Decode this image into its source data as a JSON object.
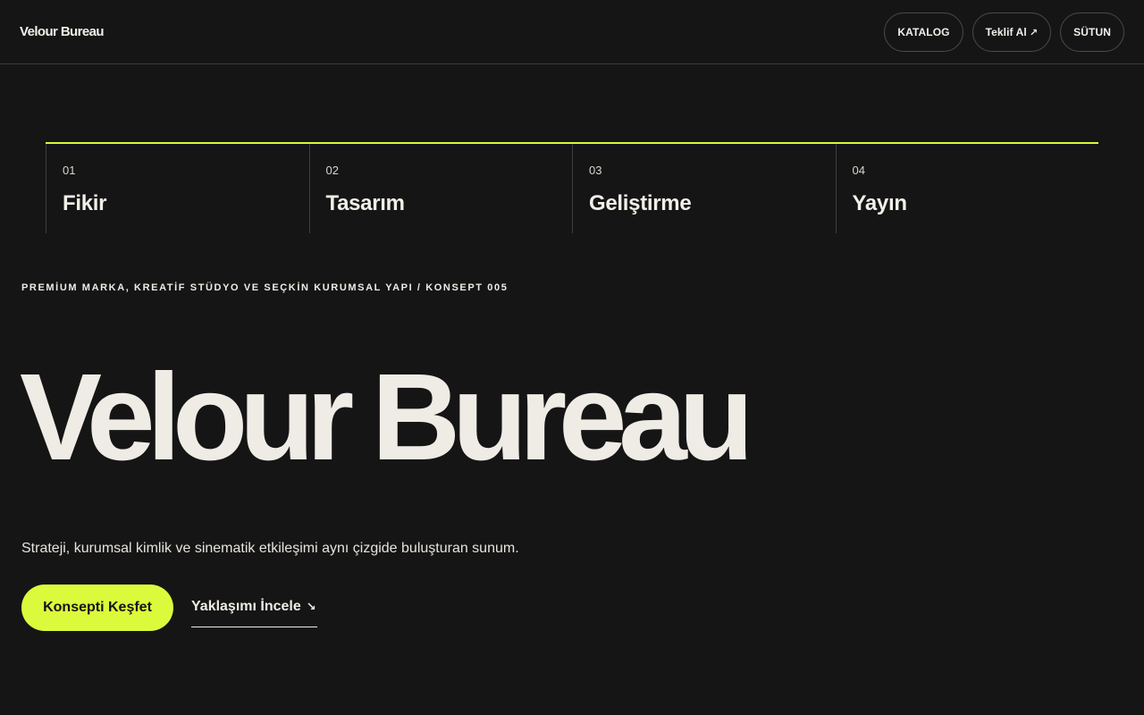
{
  "header": {
    "brand": "Velour Bureau",
    "nav": [
      {
        "label": "KATALOG",
        "icon": ""
      },
      {
        "label": "Teklif Al",
        "icon": "↗"
      },
      {
        "label": "SÜTUN",
        "icon": ""
      }
    ]
  },
  "steps": [
    {
      "num": "01",
      "title": "Fikir"
    },
    {
      "num": "02",
      "title": "Tasarım"
    },
    {
      "num": "03",
      "title": "Geliştirme"
    },
    {
      "num": "04",
      "title": "Yayın"
    }
  ],
  "hero": {
    "eyebrow": "PREMİUM MARKA, KREATİF STÜDYO VE SEÇKİN KURUMSAL YAPI / KONSEPT 005",
    "title": "Velour Bureau",
    "lead": "Strateji, kurumsal kimlik ve sinematik etkileşimi aynı çizgide buluşturan sunum.",
    "cta_primary": "Konsepti Keşfet",
    "cta_secondary": "Yaklaşımı İncele",
    "cta_secondary_icon": "↘"
  },
  "colors": {
    "background": "#151515",
    "accent": "#dcfa3c",
    "text": "#efebe5"
  }
}
